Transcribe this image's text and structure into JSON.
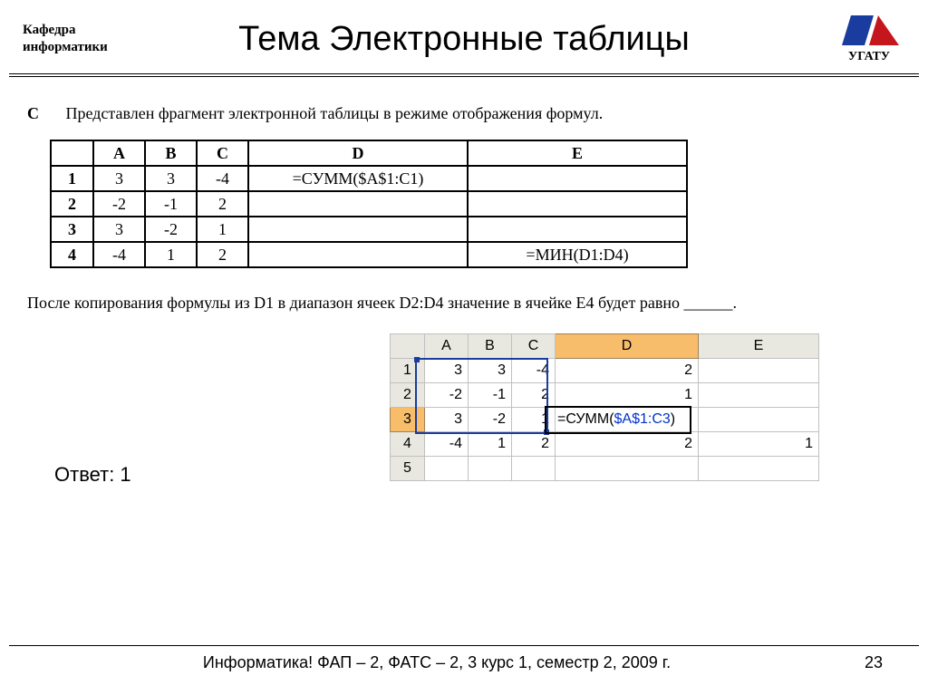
{
  "header": {
    "dept_line1": "Кафедра",
    "dept_line2": "информатики",
    "title": "Тема Электронные таблицы",
    "logo_text": "УГАТУ"
  },
  "intro": {
    "label": "C",
    "text": "Представлен фрагмент электронной таблицы в режиме отображения формул."
  },
  "table1": {
    "headers": [
      "",
      "A",
      "B",
      "C",
      "D",
      "E"
    ],
    "rows": [
      {
        "n": "1",
        "a": "3",
        "b": "3",
        "c": "-4",
        "d": "=СУММ($A$1:C1)",
        "e": ""
      },
      {
        "n": "2",
        "a": "-2",
        "b": "-1",
        "c": "2",
        "d": "",
        "e": ""
      },
      {
        "n": "3",
        "a": "3",
        "b": "-2",
        "c": "1",
        "d": "",
        "e": ""
      },
      {
        "n": "4",
        "a": "-4",
        "b": "1",
        "c": "2",
        "d": "",
        "e": "=МИН(D1:D4)"
      }
    ]
  },
  "after_text": "После копирования формулы из D1 в диапазон ячеек D2:D4 значение в ячейке E4 будет равно ______.",
  "excel": {
    "headers": [
      "",
      "A",
      "B",
      "C",
      "D",
      "E"
    ],
    "rows": [
      {
        "n": "1",
        "a": "3",
        "b": "3",
        "c": "-4",
        "d": "2",
        "e": ""
      },
      {
        "n": "2",
        "a": "-2",
        "b": "-1",
        "c": "2",
        "d": "1",
        "e": ""
      },
      {
        "n": "3",
        "a": "3",
        "b": "-2",
        "c": "1",
        "d_formula_prefix": "=СУММ(",
        "d_formula_ref": "$A$1:C3",
        "d_formula_suffix": ")",
        "e": ""
      },
      {
        "n": "4",
        "a": "-4",
        "b": "1",
        "c": "2",
        "d": "2",
        "e": "1"
      },
      {
        "n": "5",
        "a": "",
        "b": "",
        "c": "",
        "d": "",
        "e": ""
      }
    ]
  },
  "answer": "Ответ: 1",
  "footer": {
    "text": "Информатика! ФАП – 2, ФАТС – 2, 3 курс 1, семестр 2, 2009 г.",
    "page": "23"
  }
}
